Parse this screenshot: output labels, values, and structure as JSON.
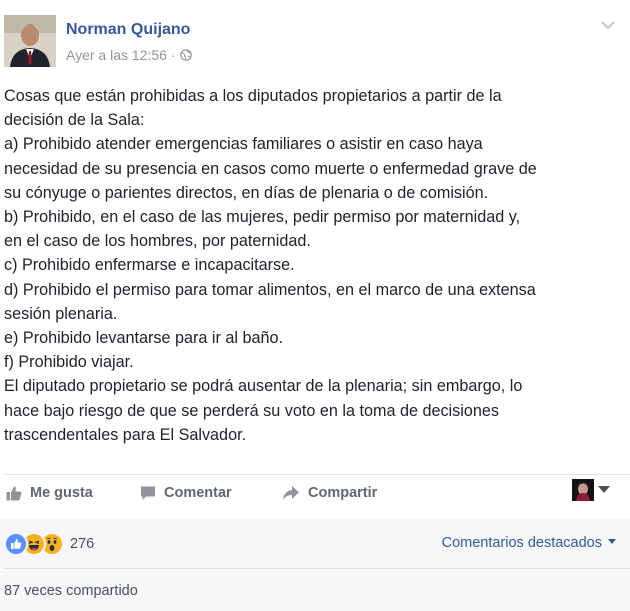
{
  "post": {
    "author": "Norman Quijano",
    "timestamp": "Ayer a las 12:56",
    "audience_icon": "globe-icon",
    "text": "Cosas que están prohibidas a los diputados propietarios a partir de la\ndecisión de la Sala:\na) Prohibido atender emergencias familiares o asistir en caso haya\nnecesidad de su presencia en casos como muerte o enfermedad grave de\nsu cónyuge o parientes directos, en días de plenaria o de comisión.\nb) Prohibido, en el caso de las mujeres, pedir permiso por maternidad y,\nen el caso de los hombres, por paternidad.\nc) Prohibido enfermarse e incapacitarse.\nd) Prohibido el permiso para tomar alimentos, en el marco de una extensa\nsesión plenaria.\ne) Prohibido levantarse para ir al baño.\nf) Prohibido viajar.\nEl diputado propietario se podrá ausentar de la plenaria; sin embargo, lo\nhace bajo riesgo de que se perderá su voto en la toma de decisiones\ntrascendentales para El Salvador."
  },
  "actions": {
    "like": "Me gusta",
    "comment": "Comentar",
    "share": "Compartir"
  },
  "footer": {
    "reactions": [
      "like",
      "haha",
      "wow"
    ],
    "reaction_count": "276",
    "featured_comments": "Comentarios destacados",
    "share_count": "87 veces compartido"
  },
  "colors": {
    "link_blue": "#365899",
    "text": "#1d2129",
    "muted": "#90949c",
    "like_blue": "#5890ff",
    "reaction_yellow": "#f7b125"
  }
}
